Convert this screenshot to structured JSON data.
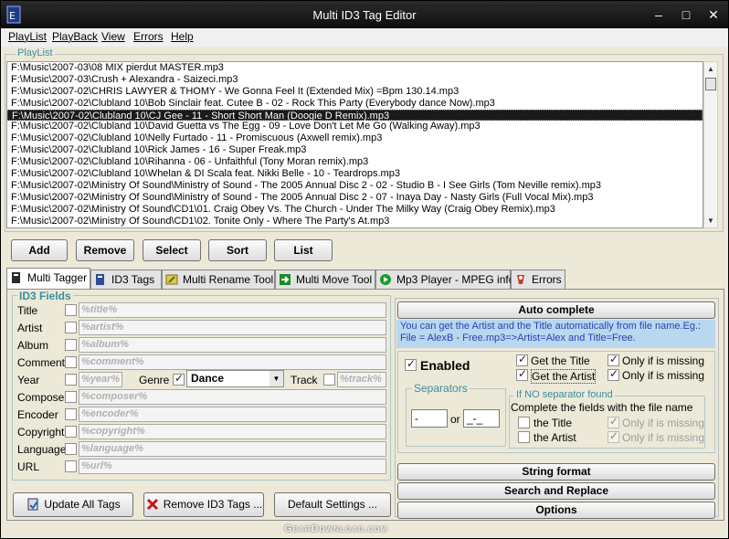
{
  "window": {
    "title": "Multi ID3 Tag Editor",
    "minimize": "–",
    "maximize": "□",
    "close": "✕"
  },
  "menu": [
    "PlayList",
    "PlayBack",
    "View",
    "Errors",
    "Help"
  ],
  "playlist": {
    "label": "PlayList",
    "items": [
      "F:\\Music\\2007-03\\08 MIX pierdut MASTER.mp3",
      "F:\\Music\\2007-03\\Crush + Alexandra - Saizeci.mp3",
      "F:\\Music\\2007-02\\CHRIS LAWYER & THOMY - We Gonna Feel It (Extended Mix) =Bpm 130.14.mp3",
      "F:\\Music\\2007-02\\Clubland 10\\Bob Sinclair feat. Cutee B - 02 - Rock This Party (Everybody dance Now).mp3",
      "F:\\Music\\2007-02\\Clubland 10\\CJ Gee - 11 - Short Short Man (Doogie D Remix).mp3",
      "F:\\Music\\2007-02\\Clubland 10\\David Guetta vs The Egg - 09 - Love Don't Let Me Go (Walking Away).mp3",
      "F:\\Music\\2007-02\\Clubland 10\\Nelly Furtado - 11 - Promiscuous (Axwell remix).mp3",
      "F:\\Music\\2007-02\\Clubland 10\\Rick James - 16 - Super Freak.mp3",
      "F:\\Music\\2007-02\\Clubland 10\\Rihanna - 06 - Unfaithful (Tony Moran remix).mp3",
      "F:\\Music\\2007-02\\Clubland 10\\Whelan & DI Scala feat. Nikki Belle - 10 - Teardrops.mp3",
      "F:\\Music\\2007-02\\Ministry Of Sound\\Ministry of Sound - The 2005 Annual Disc 2 - 02 - Studio B - I See Girls (Tom Neville remix).mp3",
      "F:\\Music\\2007-02\\Ministry Of Sound\\Ministry of Sound - The 2005 Annual Disc 2 - 07 - Inaya Day - Nasty Girls (Full Vocal Mix).mp3",
      "F:\\Music\\2007-02\\Ministry Of Sound\\CD1\\01. Craig Obey Vs. The Church - Under The Milky Way (Craig Obey Remix).mp3",
      "F:\\Music\\2007-02\\Ministry Of Sound\\CD1\\02. Tonite Only - Where The Party's At.mp3"
    ],
    "selected_index": 4
  },
  "playlist_buttons": {
    "add": "Add",
    "remove": "Remove",
    "select": "Select",
    "sort": "Sort",
    "list": "List"
  },
  "tabs": [
    "Multi Tagger",
    "ID3 Tags",
    "Multi Rename Tool",
    "Multi Move Tool",
    "Mp3 Player - MPEG info",
    "Errors"
  ],
  "id3_fields": {
    "label": "ID3 Fields",
    "title": {
      "label": "Title",
      "placeholder": "%title%"
    },
    "artist": {
      "label": "Artist",
      "placeholder": "%artist%"
    },
    "album": {
      "label": "Album",
      "placeholder": "%album%"
    },
    "comment": {
      "label": "Comment",
      "placeholder": "%comment%"
    },
    "year": {
      "label": "Year",
      "placeholder": "%year%"
    },
    "genre": {
      "label": "Genre",
      "value": "Dance",
      "checked": true
    },
    "track": {
      "label": "Track",
      "placeholder": "%track%"
    },
    "composer": {
      "label": "Composer",
      "placeholder": "%composer%"
    },
    "encoder": {
      "label": "Encoder",
      "placeholder": "%encoder%"
    },
    "copyright": {
      "label": "Copyright",
      "placeholder": "%copyright%"
    },
    "language": {
      "label": "Language",
      "placeholder": "%language%"
    },
    "url": {
      "label": "URL",
      "placeholder": "%url%"
    }
  },
  "bottom_buttons": {
    "update": "Update All Tags",
    "remove": "Remove ID3 Tags ...",
    "default": "Default Settings ..."
  },
  "auto_complete": {
    "button": "Auto complete",
    "info": "You can get the Artist and the Title automatically from file name.Eg.: File = AlexB - Free.mp3=>Artist=Alex and Title=Free.",
    "enabled": "Enabled",
    "get_title": "Get the Title",
    "get_artist": "Get the Artist",
    "only_missing_1": "Only if is missing",
    "only_missing_2": "Only if is missing",
    "separators_label": "Separators",
    "sep1": "-",
    "or": "or",
    "sep2": "_-_",
    "no_sep_label": "If NO separator found",
    "complete_text": "Complete the fields with the file name",
    "the_title": "the Title",
    "the_artist": "the Artist",
    "only_missing_3": "Only if is missing",
    "only_missing_4": "Only if is missing"
  },
  "right_buttons": {
    "string_format": "String format",
    "search_replace": "Search and Replace",
    "options": "Options"
  },
  "watermark": "GearDownload.com"
}
